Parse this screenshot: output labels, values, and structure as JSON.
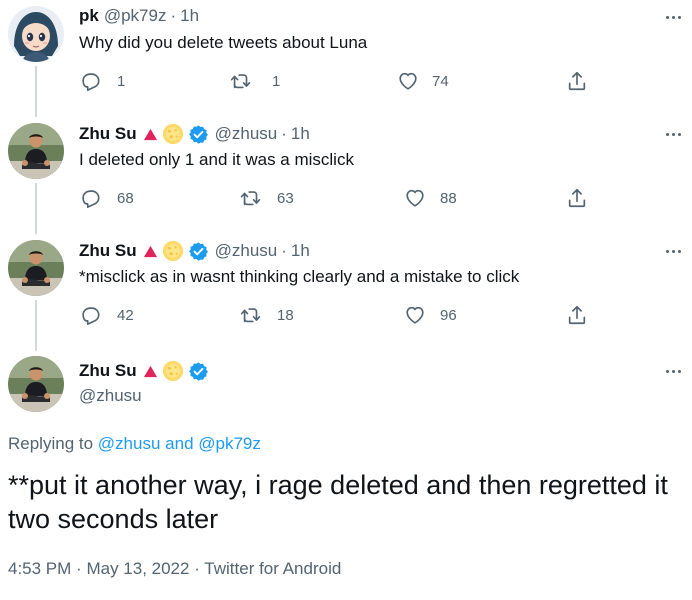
{
  "tweets": [
    {
      "name": "pk",
      "handle": "@pk79z",
      "time": "1h",
      "text": "Why did you delete tweets about Luna",
      "replies": "1",
      "retweets": "1",
      "likes": "74",
      "avatar": "anime-girl-avatar"
    },
    {
      "name": "Zhu Su",
      "handle": "@zhusu",
      "time": "1h",
      "text": "I deleted only 1 and it was a misclick",
      "replies": "68",
      "retweets": "63",
      "likes": "88",
      "avatar": "man-sitting-avatar"
    },
    {
      "name": "Zhu Su",
      "handle": "@zhusu",
      "time": "1h",
      "text": "*misclick as in wasnt thinking clearly and a mistake to click",
      "replies": "42",
      "retweets": "18",
      "likes": "96",
      "avatar": "man-sitting-avatar"
    }
  ],
  "main": {
    "name": "Zhu Su",
    "handle": "@zhusu",
    "replying_prefix": "Replying to",
    "replying_user1": "@zhusu",
    "replying_and": "and",
    "replying_user2": "@pk79z",
    "text": "**put it another way, i rage deleted and then regretted it two seconds later",
    "time": "4:53 PM",
    "date": "May 13, 2022",
    "source": "Twitter for Android"
  },
  "separator": "·",
  "colors": {
    "accent": "#1d9bf0",
    "secondary_text": "#536471",
    "primary_text": "#0f1419",
    "thread_line": "#cfd9de",
    "red_triangle": "#e0245e",
    "sun_emoji": "#fcd96b"
  },
  "icons": [
    "reply-icon",
    "retweet-icon",
    "like-icon",
    "share-icon",
    "more-icon",
    "verified-badge-icon",
    "red-triangle-icon",
    "sun-emoji-icon"
  ]
}
